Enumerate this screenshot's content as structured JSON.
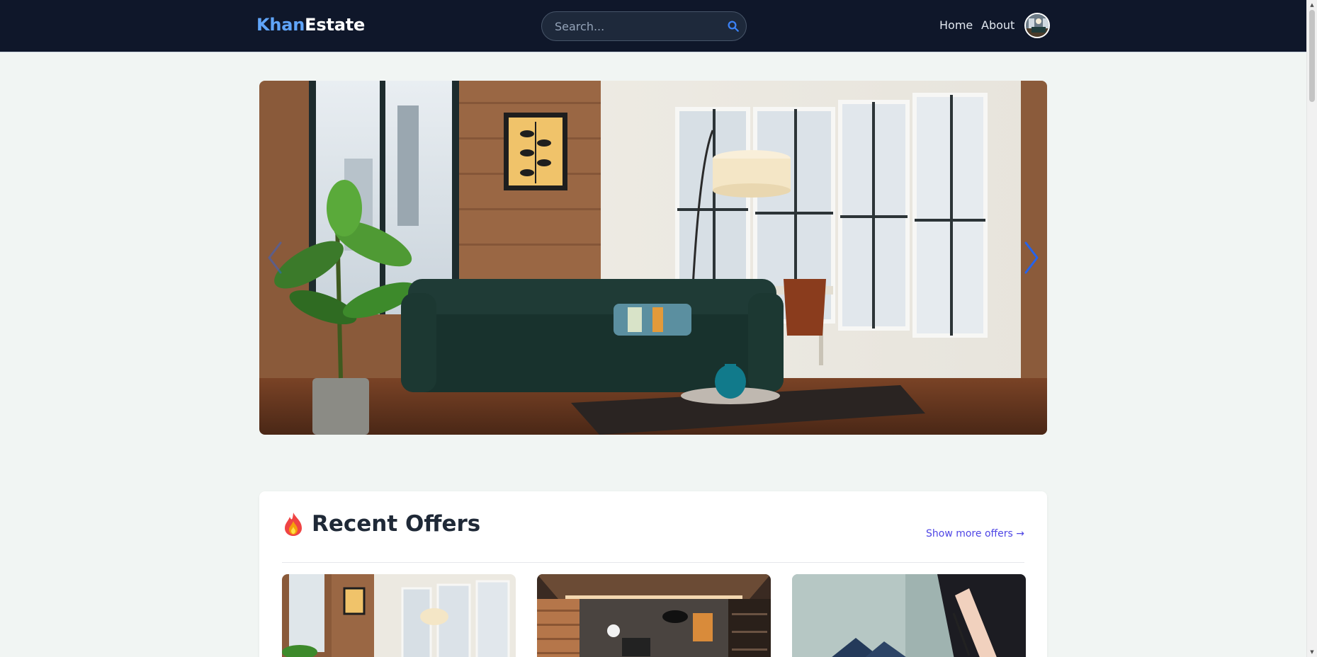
{
  "brand": {
    "part1": "Khan",
    "part2": "Estate"
  },
  "search": {
    "placeholder": "Search..."
  },
  "nav": {
    "home": "Home",
    "about": "About"
  },
  "offers": {
    "title": "Recent Offers",
    "show_more": "Show more offers →"
  },
  "icons": {
    "search": "search-icon",
    "avatar": "avatar",
    "fire": "fire-icon",
    "carousel_prev": "chevron-left-icon",
    "carousel_next": "chevron-right-icon"
  },
  "colors": {
    "navbar_bg": "#0f172a",
    "brand_accent": "#60a5fa",
    "link": "#4f46e5",
    "carousel_arrow": "#2563eb",
    "page_bg": "#f1f5f3"
  }
}
